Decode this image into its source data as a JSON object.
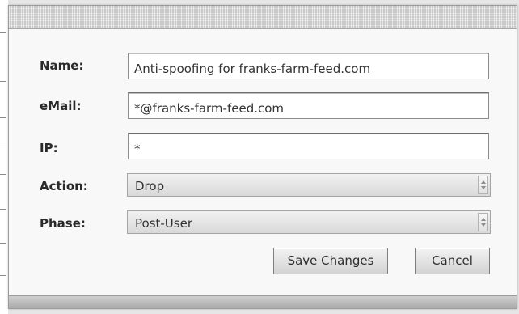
{
  "form": {
    "name": {
      "label": "Name:",
      "value": "Anti-spoofing for franks-farm-feed.com"
    },
    "email": {
      "label": "eMail:",
      "value": "*@franks-farm-feed.com"
    },
    "ip": {
      "label": "IP:",
      "value": "*"
    },
    "action": {
      "label": "Action:",
      "selected": "Drop"
    },
    "phase": {
      "label": "Phase:",
      "selected": "Post-User"
    }
  },
  "buttons": {
    "save_label": "Save Changes",
    "cancel_label": "Cancel"
  },
  "icons": {
    "select_arrows": "up-down-arrows-icon"
  },
  "colors": {
    "dialog_background": "#f7f7f7",
    "titlebar": "#c8c8c8",
    "button_border": "#7f7f7f"
  }
}
